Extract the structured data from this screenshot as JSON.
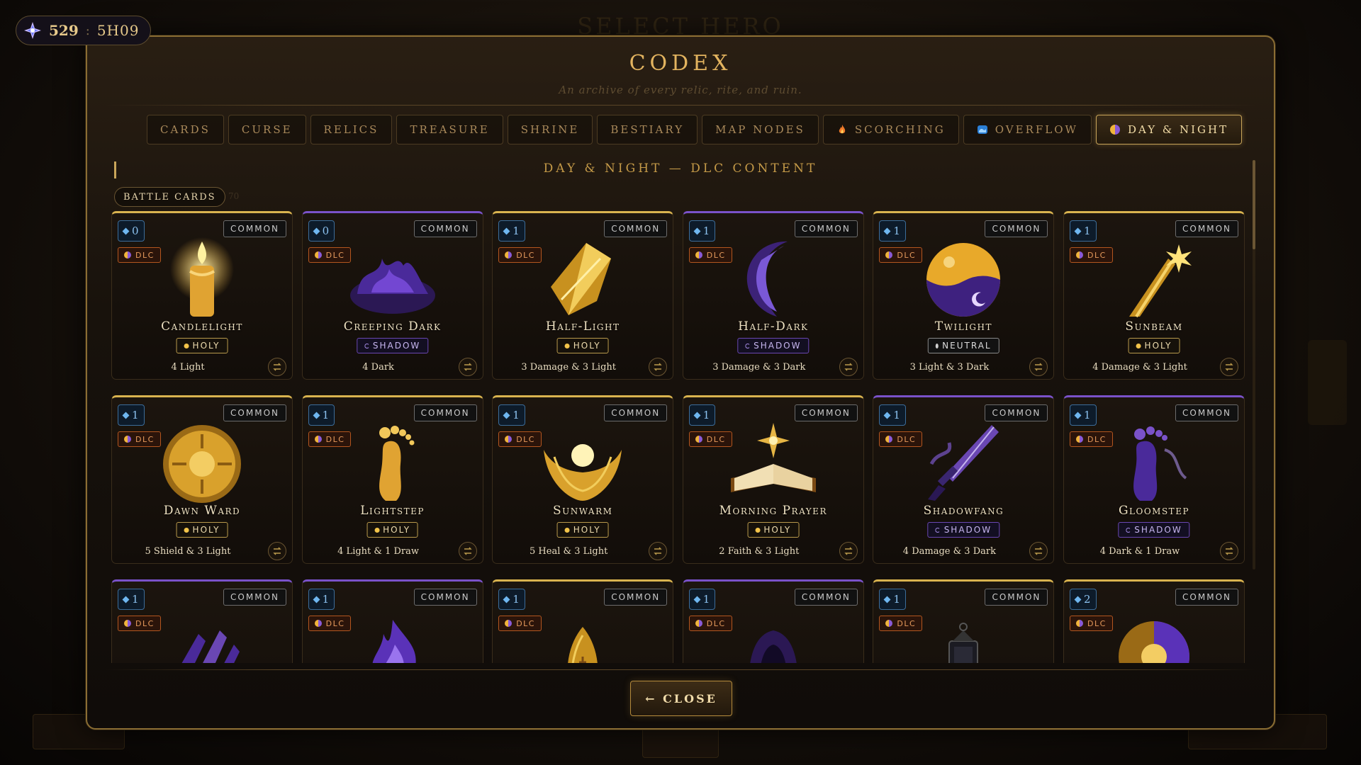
{
  "currency": {
    "gems": "529",
    "separator": ":",
    "timer": "5H09",
    "icon": "gem-icon"
  },
  "background": {
    "title": "SELECT HERO"
  },
  "modal": {
    "title": "CODEX",
    "subtitle": "An archive of every relic, rite, and ruin.",
    "section_heading": "DAY & NIGHT — DLC CONTENT",
    "battle_cards_label": "BATTLE CARDS",
    "battle_cards_count": "70",
    "close_label": "← CLOSE"
  },
  "tabs": [
    {
      "label": "CARDS",
      "icon": ""
    },
    {
      "label": "CURSE",
      "icon": ""
    },
    {
      "label": "RELICS",
      "icon": ""
    },
    {
      "label": "TREASURE",
      "icon": ""
    },
    {
      "label": "SHRINE",
      "icon": ""
    },
    {
      "label": "BESTIARY",
      "icon": ""
    },
    {
      "label": "MAP NODES",
      "icon": ""
    },
    {
      "label": "SCORCHING",
      "icon": "flame-icon"
    },
    {
      "label": "OVERFLOW",
      "icon": "wave-icon"
    },
    {
      "label": "DAY & NIGHT",
      "icon": "day-night-icon",
      "active": true
    }
  ],
  "colors": {
    "accent": "#c9a55a",
    "holy": "#d9b34f",
    "shadow": "#7a52c9",
    "dlc": "#b3561f",
    "cost": "#3c6d9a"
  },
  "cards": [
    {
      "cost": "0",
      "rarity": "COMMON",
      "dlc": "DLC",
      "name": "Candlelight",
      "type": "HOLY",
      "kind": "holy",
      "effect": "4 Light",
      "art": "candle-icon"
    },
    {
      "cost": "0",
      "rarity": "COMMON",
      "dlc": "DLC",
      "name": "Creeping Dark",
      "type": "SHADOW",
      "kind": "shadow",
      "effect": "4 Dark",
      "art": "dark-mist-icon"
    },
    {
      "cost": "1",
      "rarity": "COMMON",
      "dlc": "DLC",
      "name": "Half-Light",
      "type": "HOLY",
      "kind": "holy",
      "effect": "3 Damage & 3 Light",
      "art": "light-shard-icon"
    },
    {
      "cost": "1",
      "rarity": "COMMON",
      "dlc": "DLC",
      "name": "Half-Dark",
      "type": "SHADOW",
      "kind": "shadow",
      "effect": "3 Damage & 3 Dark",
      "art": "dark-crescent-icon"
    },
    {
      "cost": "1",
      "rarity": "COMMON",
      "dlc": "DLC",
      "name": "Twilight",
      "type": "NEUTRAL",
      "kind": "neutral",
      "effect": "3 Light & 3 Dark",
      "art": "twilight-orb-icon"
    },
    {
      "cost": "1",
      "rarity": "COMMON",
      "dlc": "DLC",
      "name": "Sunbeam",
      "type": "HOLY",
      "kind": "holy",
      "effect": "4 Damage & 3 Light",
      "art": "sunbeam-icon"
    },
    {
      "cost": "1",
      "rarity": "COMMON",
      "dlc": "DLC",
      "name": "Dawn Ward",
      "type": "HOLY",
      "kind": "holy",
      "effect": "5 Shield & 3 Light",
      "art": "sun-shield-icon"
    },
    {
      "cost": "1",
      "rarity": "COMMON",
      "dlc": "DLC",
      "name": "Lightstep",
      "type": "HOLY",
      "kind": "holy",
      "effect": "4 Light & 1 Draw",
      "art": "golden-foot-icon"
    },
    {
      "cost": "1",
      "rarity": "COMMON",
      "dlc": "DLC",
      "name": "Sunwarm",
      "type": "HOLY",
      "kind": "holy",
      "effect": "5 Heal & 3 Light",
      "art": "cupped-hands-icon"
    },
    {
      "cost": "1",
      "rarity": "COMMON",
      "dlc": "DLC",
      "name": "Morning Prayer",
      "type": "HOLY",
      "kind": "holy",
      "effect": "2 Faith & 3 Light",
      "art": "prayer-book-icon"
    },
    {
      "cost": "1",
      "rarity": "COMMON",
      "dlc": "DLC",
      "name": "Shadowfang",
      "type": "SHADOW",
      "kind": "shadow",
      "effect": "4 Damage & 3 Dark",
      "art": "shadow-dagger-icon"
    },
    {
      "cost": "1",
      "rarity": "COMMON",
      "dlc": "DLC",
      "name": "Gloomstep",
      "type": "SHADOW",
      "kind": "shadow",
      "effect": "4 Dark & 1 Draw",
      "art": "shadow-foot-icon"
    },
    {
      "cost": "1",
      "rarity": "COMMON",
      "dlc": "DLC",
      "name": "",
      "type": "",
      "kind": "shadow",
      "effect": "",
      "art": "shadow-claw-icon"
    },
    {
      "cost": "1",
      "rarity": "COMMON",
      "dlc": "DLC",
      "name": "",
      "type": "",
      "kind": "shadow",
      "effect": "",
      "art": "shadow-flame-icon"
    },
    {
      "cost": "1",
      "rarity": "COMMON",
      "dlc": "DLC",
      "name": "",
      "type": "",
      "kind": "holy",
      "effect": "",
      "art": "rune-stone-icon"
    },
    {
      "cost": "1",
      "rarity": "COMMON",
      "dlc": "DLC",
      "name": "",
      "type": "",
      "kind": "shadow",
      "effect": "",
      "art": "hooded-figure-icon"
    },
    {
      "cost": "1",
      "rarity": "COMMON",
      "dlc": "DLC",
      "name": "",
      "type": "",
      "kind": "neutral",
      "effect": "",
      "art": "lantern-icon"
    },
    {
      "cost": "2",
      "rarity": "COMMON",
      "dlc": "DLC",
      "name": "",
      "type": "",
      "kind": "holy",
      "effect": "",
      "art": "eclipse-shield-icon"
    }
  ]
}
